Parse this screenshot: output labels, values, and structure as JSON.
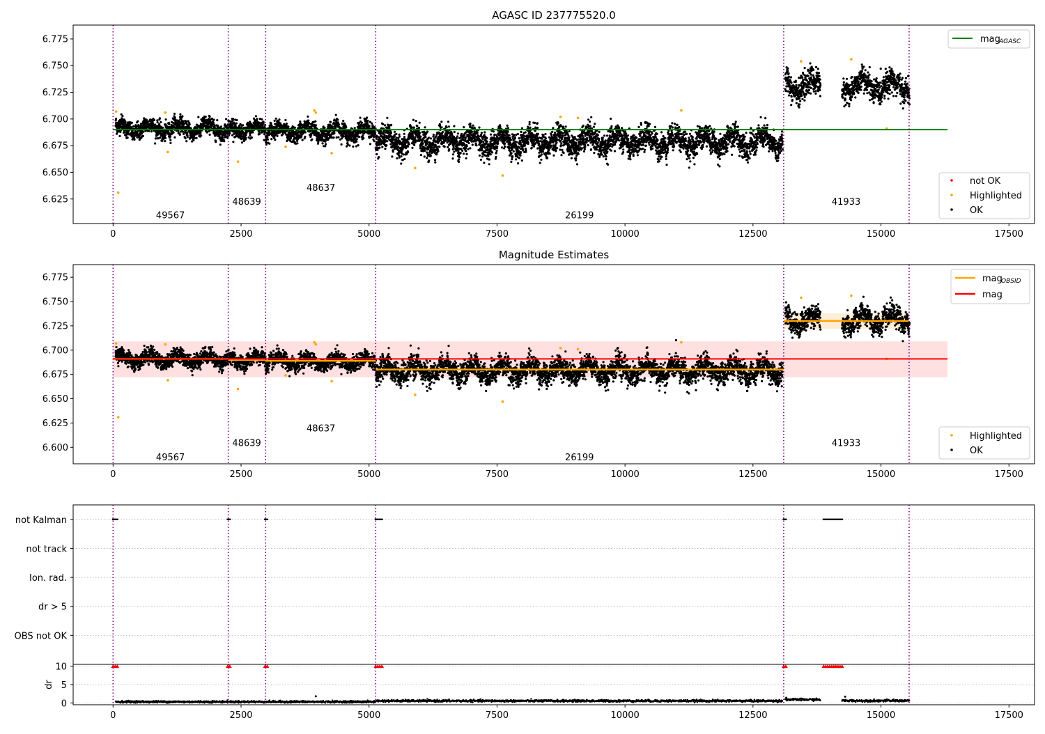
{
  "figure": {
    "panel1_title": "AGASC ID 237775520.0",
    "panel2_title": "Magnitude Estimates"
  },
  "colors": {
    "agasc_line": "#008000",
    "mag_line": "#ff0000",
    "mag_band": "#ffe0e0",
    "obsid_line": "#ffa500",
    "obsid_band": "#ffe8cc",
    "ok_points": "#000000",
    "highlighted_points": "#ffa500",
    "not_ok_points": "#ff0000",
    "obsid_boundary": "#800080",
    "flag_marker": "#ff0000",
    "grid": "#b0b0b0"
  },
  "legends": {
    "panel1_upper": [
      {
        "label": "mag",
        "subscript": "AGASC",
        "color": "#008000"
      }
    ],
    "panel1_lower": [
      {
        "label": "not OK",
        "color": "#ff0000"
      },
      {
        "label": "Highlighted",
        "color": "#ffa500"
      },
      {
        "label": "OK",
        "color": "#000000"
      }
    ],
    "panel2_upper": [
      {
        "label": "mag",
        "subscript": "OBSID",
        "color": "#ffa500"
      },
      {
        "label": "mag",
        "subscript": "",
        "color": "#ff0000"
      }
    ],
    "panel2_lower": [
      {
        "label": "Highlighted",
        "color": "#ffa500"
      },
      {
        "label": "OK",
        "color": "#000000"
      }
    ]
  },
  "chart_data": [
    {
      "type": "scatter",
      "title": "AGASC ID 237775520.0",
      "xlim": [
        -780,
        18000
      ],
      "ylim": [
        6.602,
        6.788
      ],
      "xticks": [
        0,
        2500,
        5000,
        7500,
        10000,
        12500,
        15000,
        17500
      ],
      "xtick_labels": [
        "0",
        "2500",
        "5000",
        "7500",
        "10000",
        "12500",
        "15000",
        "17500"
      ],
      "yticks": [
        6.625,
        6.65,
        6.675,
        6.7,
        6.725,
        6.75,
        6.775
      ],
      "ytick_labels": [
        "6.625",
        "6.650",
        "6.675",
        "6.700",
        "6.725",
        "6.750",
        "6.775"
      ],
      "agasc_mag": 6.69,
      "agasc_line_x": [
        0,
        16300
      ],
      "obsid_boundaries": [
        0,
        2250,
        2980,
        5130,
        13100,
        15550
      ],
      "obsid_labels": [
        {
          "text": "49567",
          "x": 1120,
          "y": 6.61
        },
        {
          "text": "48639",
          "x": 2610,
          "y": 6.623
        },
        {
          "text": "48637",
          "x": 4060,
          "y": 6.636
        },
        {
          "text": "26199",
          "x": 9110,
          "y": 6.61
        },
        {
          "text": "41933",
          "x": 14320,
          "y": 6.623
        }
      ],
      "ok_segments": [
        {
          "x": [
            50,
            2250
          ],
          "mean": 6.691,
          "spread": 0.007
        },
        {
          "x": [
            2250,
            2980
          ],
          "mean": 6.69,
          "spread": 0.007
        },
        {
          "x": [
            2980,
            5130
          ],
          "mean": 6.688,
          "spread": 0.007
        },
        {
          "x": [
            5130,
            13080
          ],
          "mean": 6.679,
          "spread": 0.01
        },
        {
          "x": [
            13130,
            13820
          ],
          "mean": 6.731,
          "spread": 0.01
        },
        {
          "x": [
            14240,
            15560
          ],
          "mean": 6.731,
          "spread": 0.01
        }
      ],
      "highlighted_points": [
        [
          60,
          6.707
        ],
        [
          100,
          6.631
        ],
        [
          1020,
          6.706
        ],
        [
          1070,
          6.669
        ],
        [
          2440,
          6.66
        ],
        [
          3370,
          6.674
        ],
        [
          3930,
          6.708
        ],
        [
          3960,
          6.706
        ],
        [
          4270,
          6.668
        ],
        [
          5900,
          6.654
        ],
        [
          7610,
          6.647
        ],
        [
          8740,
          6.702
        ],
        [
          9080,
          6.701
        ],
        [
          11100,
          6.708
        ],
        [
          13440,
          6.754
        ],
        [
          14420,
          6.756
        ],
        [
          15110,
          6.691
        ]
      ]
    },
    {
      "type": "scatter",
      "title": "Magnitude Estimates",
      "xlim": [
        -780,
        18000
      ],
      "ylim": [
        6.583,
        6.788
      ],
      "xticks": [
        0,
        2500,
        5000,
        7500,
        10000,
        12500,
        15000,
        17500
      ],
      "xtick_labels": [
        "0",
        "2500",
        "5000",
        "7500",
        "10000",
        "12500",
        "15000",
        "17500"
      ],
      "yticks": [
        6.6,
        6.625,
        6.65,
        6.675,
        6.7,
        6.725,
        6.75,
        6.775
      ],
      "ytick_labels": [
        "6.600",
        "6.625",
        "6.650",
        "6.675",
        "6.700",
        "6.725",
        "6.750",
        "6.775"
      ],
      "mag": 6.691,
      "mag_band": [
        6.672,
        6.709
      ],
      "mag_line_x": [
        0,
        16300
      ],
      "obsid_mags": [
        {
          "x": [
            0,
            2250
          ],
          "mag": 6.691,
          "err": 0.002
        },
        {
          "x": [
            2250,
            2980
          ],
          "mag": 6.69,
          "err": 0.002
        },
        {
          "x": [
            2980,
            5130
          ],
          "mag": 6.689,
          "err": 0.002
        },
        {
          "x": [
            5130,
            13100
          ],
          "mag": 6.68,
          "err": 0.002
        },
        {
          "x": [
            13100,
            15550
          ],
          "mag": 6.73,
          "err": 0.008
        }
      ],
      "obsid_boundaries": [
        0,
        2250,
        2980,
        5130,
        13100,
        15550
      ],
      "obsid_labels": [
        {
          "text": "49567",
          "x": 1120,
          "y": 6.59
        },
        {
          "text": "48639",
          "x": 2610,
          "y": 6.605
        },
        {
          "text": "48637",
          "x": 4060,
          "y": 6.62
        },
        {
          "text": "26199",
          "x": 9110,
          "y": 6.59
        },
        {
          "text": "41933",
          "x": 14320,
          "y": 6.605
        }
      ],
      "ok_segments": [
        {
          "x": [
            50,
            2250
          ],
          "mean": 6.691,
          "spread": 0.007
        },
        {
          "x": [
            2250,
            2980
          ],
          "mean": 6.69,
          "spread": 0.007
        },
        {
          "x": [
            2980,
            5130
          ],
          "mean": 6.688,
          "spread": 0.007
        },
        {
          "x": [
            5130,
            13080
          ],
          "mean": 6.679,
          "spread": 0.01
        },
        {
          "x": [
            13130,
            13820
          ],
          "mean": 6.731,
          "spread": 0.01
        },
        {
          "x": [
            14240,
            15560
          ],
          "mean": 6.731,
          "spread": 0.01
        }
      ],
      "highlighted_points": [
        [
          60,
          6.707
        ],
        [
          100,
          6.631
        ],
        [
          1020,
          6.706
        ],
        [
          1070,
          6.669
        ],
        [
          2440,
          6.66
        ],
        [
          3370,
          6.674
        ],
        [
          3930,
          6.708
        ],
        [
          3960,
          6.706
        ],
        [
          4270,
          6.668
        ],
        [
          5900,
          6.654
        ],
        [
          7610,
          6.647
        ],
        [
          8740,
          6.702
        ],
        [
          9080,
          6.701
        ],
        [
          11100,
          6.708
        ],
        [
          13440,
          6.754
        ],
        [
          14420,
          6.756
        ],
        [
          15110,
          6.691
        ]
      ]
    },
    {
      "type": "scatter",
      "title": "",
      "xlim": [
        -780,
        18000
      ],
      "flag_rows": [
        "not Kalman",
        "not track",
        "Ion. rad.",
        "dr > 5",
        "OBS not OK"
      ],
      "flag_row_values": [
        5,
        4,
        3,
        2,
        1
      ],
      "flag_ylim": [
        0.0,
        5.5
      ],
      "not_kalman_x": [
        0,
        40,
        80,
        2240,
        2280,
        2970,
        3010,
        5130,
        5170,
        5210,
        5250,
        13100,
        13140,
        13880,
        13920,
        13960,
        14000,
        14040,
        14080,
        14120,
        14160,
        14200,
        14240
      ],
      "obsid_boundaries": [
        0,
        2250,
        2980,
        5130,
        13100,
        15550
      ],
      "dr_ylabel": "dr",
      "dr_yticks": [
        0,
        5,
        10
      ],
      "dr_ytick_labels": [
        "0",
        "5",
        "10"
      ],
      "dr_ylim": [
        -0.5,
        10.5
      ],
      "dr_typical": 0.3,
      "dr_segments": [
        {
          "x": [
            50,
            2250
          ],
          "level": 0.3
        },
        {
          "x": [
            2250,
            2980
          ],
          "level": 0.3
        },
        {
          "x": [
            2980,
            5130
          ],
          "level": 0.3
        },
        {
          "x": [
            5130,
            13080
          ],
          "level": 0.55
        },
        {
          "x": [
            13130,
            13820
          ],
          "level": 0.9
        },
        {
          "x": [
            14240,
            15560
          ],
          "level": 0.6
        }
      ],
      "dr_spikes": [
        [
          3960,
          1.8
        ],
        [
          13150,
          1.4
        ],
        [
          14300,
          1.7
        ]
      ],
      "dr_capped_x": [
        0,
        40,
        80,
        2240,
        2280,
        2970,
        3010,
        5130,
        5170,
        5210,
        5250,
        13100,
        13140,
        13880,
        13920,
        13960,
        14000,
        14040,
        14080,
        14120,
        14160,
        14200,
        14240
      ],
      "dr_cap_value": 10,
      "xticks": [
        0,
        2500,
        5000,
        7500,
        10000,
        12500,
        15000,
        17500
      ],
      "xtick_labels": [
        "0",
        "2500",
        "5000",
        "7500",
        "10000",
        "12500",
        "15000",
        "17500"
      ]
    }
  ]
}
